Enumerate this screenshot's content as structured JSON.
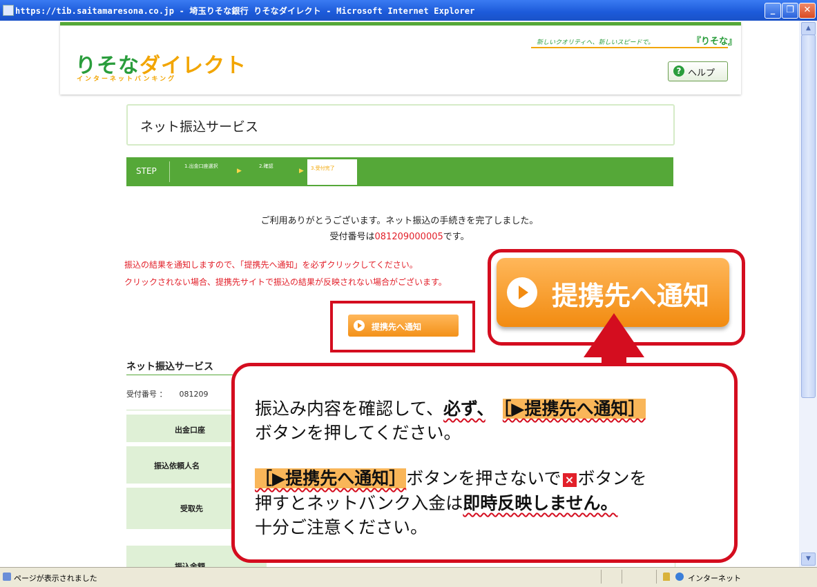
{
  "window": {
    "title": "https://tib.saitamaresona.co.jp - 埼玉りそな銀行 りそなダイレクト - Microsoft Internet Explorer",
    "minimize": "_",
    "maximize": "❐",
    "close": "✕"
  },
  "header": {
    "logo_main": "りそな",
    "logo_accent": "ダイレクト",
    "logo_sub": "インターネットバンキング",
    "slogan": "新しいクオリティへ、新しいスピードで。",
    "brand": "『りそな』",
    "help_label": "ヘルプ"
  },
  "page": {
    "title": "ネット振込サービス",
    "step_label": "STEP",
    "steps": [
      "1.出金口座選択",
      "2.確認",
      "3.受付完了"
    ],
    "thanks": "ご利用ありがとうございます。ネット振込の手続きを完了しました。",
    "receipt_prefix": "受付番号は",
    "receipt_number": "081209000005",
    "receipt_suffix": "です。",
    "warning_1": "振込の結果を通知しますので、「提携先へ通知」を必ずクリックしてください。",
    "warning_2": "クリックされない場合、提携先サイトで振込の結果が反映されない場合がございます。",
    "notify_label": "提携先へ通知",
    "section_title": "ネット振込サービス",
    "receipt_field_label": "受付番号 ：",
    "receipt_field_value": "081209",
    "table_labels": [
      "出金口座",
      "振込依頼人名",
      "受取先",
      "振込金額"
    ]
  },
  "callout": {
    "line1_a": "振込み内容を確認して、",
    "line1_b": "必ず、",
    "line1_c": "［▶提携先へ通知］",
    "line2": "ボタンを押してください。",
    "line3_a": "［▶提携先へ通知］",
    "line3_b": "ボタンを押さないで",
    "line3_c": "ボタンを",
    "line4_a": "押すとネットバンク入金は",
    "line4_b": "即時反映しません。",
    "line5": "十分ご注意ください。"
  },
  "status": {
    "text": "ページが表示されました",
    "zone": "インターネット"
  },
  "colors": {
    "brand_green": "#55a838",
    "accent_orange": "#f39119",
    "alert_red": "#d40d1f"
  }
}
